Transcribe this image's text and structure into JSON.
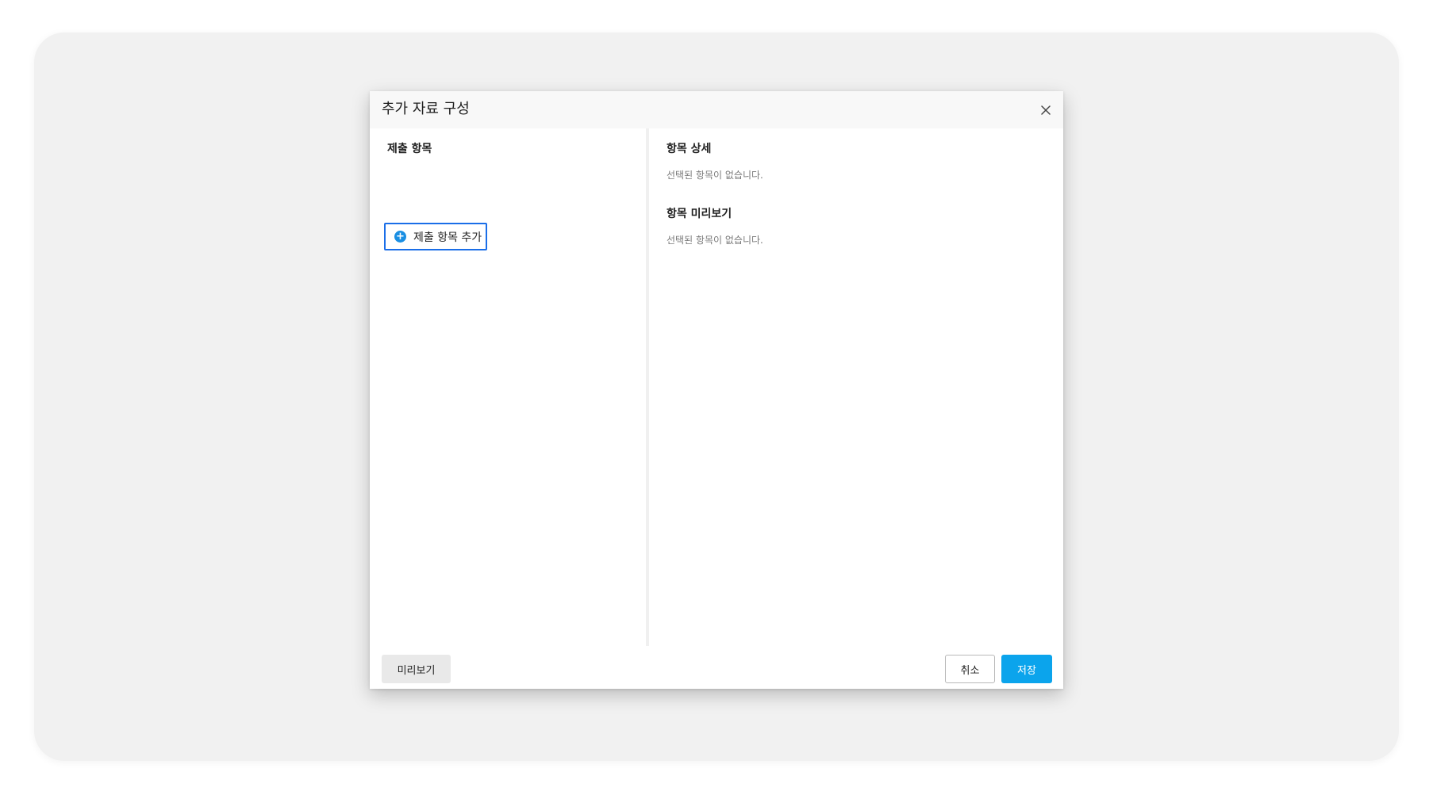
{
  "dialog": {
    "title": "추가 자료 구성",
    "close_icon": "close-icon"
  },
  "left_panel": {
    "title": "제출 항목",
    "add_button": {
      "icon": "plus-circle-icon",
      "label": "제출 항목 추가"
    }
  },
  "right_panel": {
    "details": {
      "title": "항목 상세",
      "empty_text": "선택된 항목이 없습니다."
    },
    "preview": {
      "title": "항목 미리보기",
      "empty_text": "선택된 항목이 없습니다."
    }
  },
  "footer": {
    "preview_label": "미리보기",
    "cancel_label": "취소",
    "save_label": "저장"
  },
  "colors": {
    "accent": "#0ba4ec",
    "focus_outline": "#1a6ee8"
  }
}
